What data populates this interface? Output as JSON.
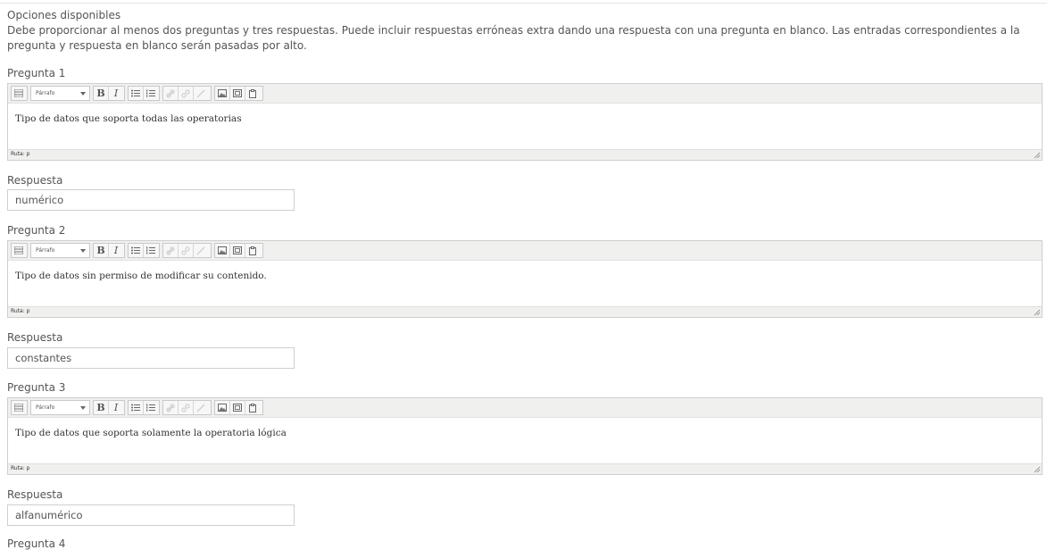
{
  "section": {
    "title": "Opciones disponibles",
    "description": "Debe proporcionar al menos dos preguntas y tres respuestas. Puede incluir respuestas erróneas extra dando una respuesta con una pregunta en blanco. Las entradas correspondientes a la pregunta y respuesta en blanco serán pasadas por alto."
  },
  "editor_common": {
    "format_option": "Párrafo",
    "path_label": "Ruta: p",
    "bold_glyph": "B",
    "italic_glyph": "I"
  },
  "questions": [
    {
      "label": "Pregunta 1",
      "text": "Tipo de datos que soporta todas las operatorias",
      "answer_label": "Respuesta",
      "answer": "numérico"
    },
    {
      "label": "Pregunta 2",
      "text": "Tipo de datos sin permiso de modificar su contenido.",
      "answer_label": "Respuesta",
      "answer": "constantes"
    },
    {
      "label": "Pregunta 3",
      "text": "Tipo de datos que soporta solamente la operatoria lógica",
      "answer_label": "Respuesta",
      "answer": "alfanumérico"
    },
    {
      "label": "Pregunta 4"
    }
  ],
  "icons": [
    "toolbar-toggle-icon",
    "bold-icon",
    "italic-icon",
    "bullet-list-icon",
    "numbered-list-icon",
    "link-icon",
    "unlink-icon",
    "anchor-icon",
    "image-icon",
    "media-icon",
    "paste-icon",
    "resize-grip-icon",
    "dropdown-arrow-icon"
  ]
}
